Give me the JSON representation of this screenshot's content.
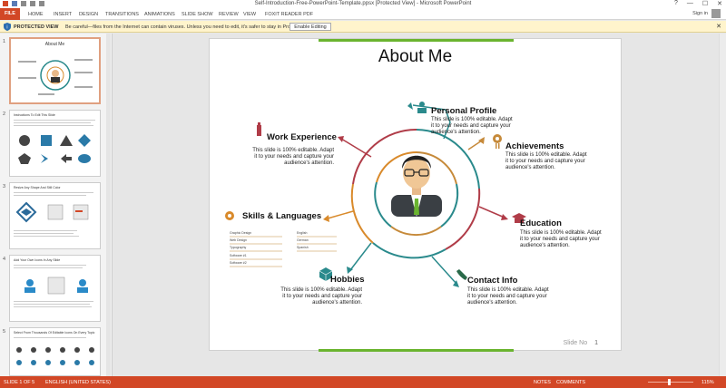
{
  "window": {
    "title": "Self-Introduction-Free-PowerPoint-Template.ppsx [Protected View] - Microsoft PowerPoint",
    "controls": [
      "?",
      "—",
      "☐",
      "✕"
    ]
  },
  "ribbon": {
    "file_label": "FILE",
    "tabs": [
      "HOME",
      "INSERT",
      "DESIGN",
      "TRANSITIONS",
      "ANIMATIONS",
      "SLIDE SHOW",
      "REVIEW",
      "VIEW",
      "FOXIT READER PDF"
    ],
    "sign_in": "Sign in"
  },
  "protected_view": {
    "label": "PROTECTED VIEW",
    "message": "Be careful—files from the Internet can contain viruses. Unless you need to edit, it's safer to stay in Protected View.",
    "button": "Enable Editing",
    "close": "✕"
  },
  "thumbnails": [
    {
      "number": "1",
      "title": "About Me"
    },
    {
      "number": "2",
      "title": "Instructions To Edit This Slide"
    },
    {
      "number": "3",
      "title": "Resize Any Shape And Still Color"
    },
    {
      "number": "4",
      "title": "Add Your Own Icons In Any Slide"
    },
    {
      "number": "5",
      "title": "Select From Thousands Of Editable Icons On Every Topic"
    }
  ],
  "slide": {
    "title": "About Me",
    "sections": {
      "personal_profile": {
        "heading": "Personal Profile",
        "text": "This slide is 100% editable. Adapt it to your needs and capture your audience's attention."
      },
      "achievements": {
        "heading": "Achievements",
        "text": "This slide is 100% editable. Adapt it to your needs and capture your audience's attention."
      },
      "education": {
        "heading": "Education",
        "text": "This slide is 100% editable. Adapt it to your needs and capture your audience's attention."
      },
      "contact_info": {
        "heading": "Contact Info",
        "text": "This slide is 100% editable. Adapt it to your needs and capture your audience's attention."
      },
      "hobbies": {
        "heading": "Hobbies",
        "text": "This slide is 100% editable. Adapt it to your needs and capture your audience's attention."
      },
      "skills": {
        "heading": "Skills & Languages"
      },
      "work_experience": {
        "heading": "Work Experience",
        "text": "This slide is 100% editable. Adapt it to your needs and capture your audience's attention."
      }
    },
    "skills_list": [
      "Graphic Design",
      "Web Design",
      "Typography",
      "Software #1",
      "Software #2"
    ],
    "languages_list": [
      "English",
      "German",
      "Spanish"
    ],
    "footer_label": "Slide No",
    "footer_number": "1"
  },
  "status": {
    "slide_info": "SLIDE 1 OF 5",
    "language": "ENGLISH (UNITED STATES)",
    "notes": "NOTES",
    "comments": "COMMENTS",
    "zoom": "115%"
  },
  "colors": {
    "accent": "#d24726",
    "teal": "#2a8a8c",
    "green": "#6ab42f",
    "brown": "#c68a3a",
    "red": "#b03c48",
    "orange": "#d98a2b"
  }
}
